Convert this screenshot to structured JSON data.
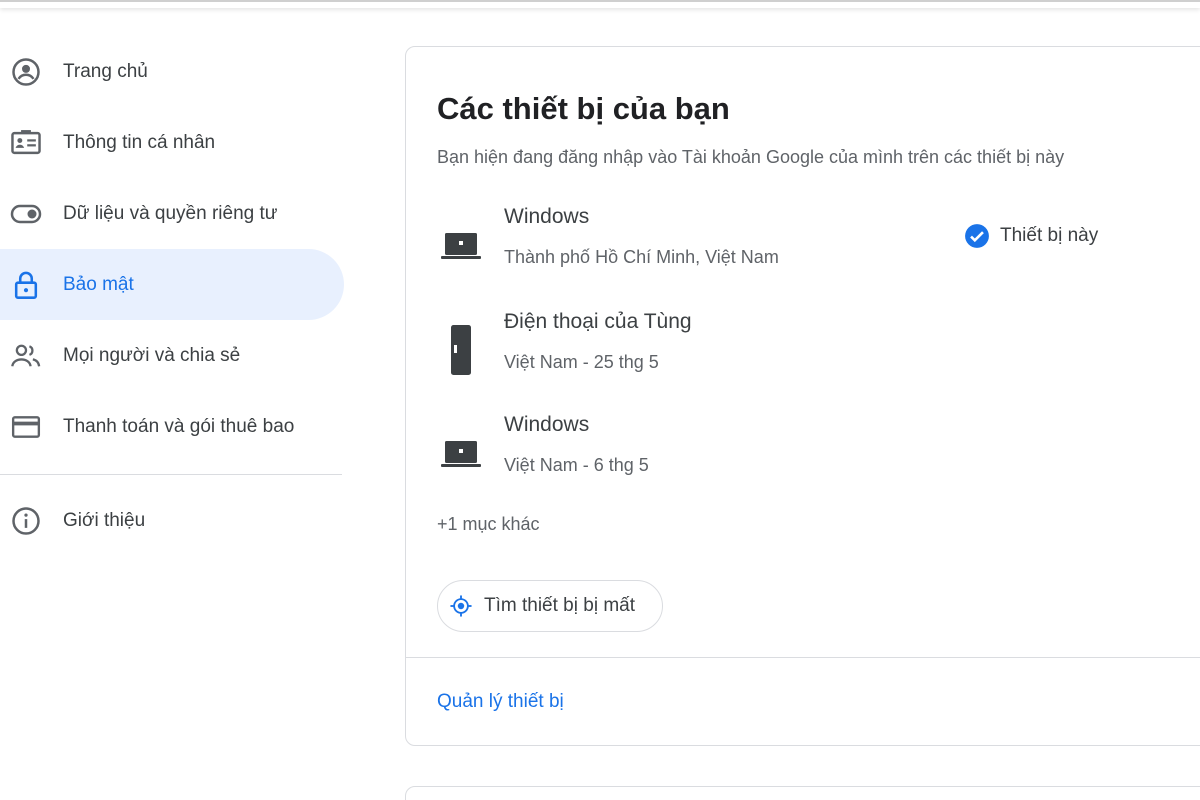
{
  "sidebar": {
    "items": [
      {
        "label": "Trang chủ",
        "icon": "home-account-icon"
      },
      {
        "label": "Thông tin cá nhân",
        "icon": "id-card-icon"
      },
      {
        "label": "Dữ liệu và quyền riêng tư",
        "icon": "toggle-icon"
      },
      {
        "label": "Bảo mật",
        "icon": "lock-icon",
        "active": true
      },
      {
        "label": "Mọi người và chia sẻ",
        "icon": "people-icon"
      },
      {
        "label": "Thanh toán và gói thuê bao",
        "icon": "credit-card-icon"
      }
    ],
    "about": {
      "label": "Giới thiệu",
      "icon": "info-icon"
    }
  },
  "devices_card": {
    "title": "Các thiết bị của bạn",
    "subtitle": "Bạn hiện đang đăng nhập vào Tài khoản Google của mình trên các thiết bị này",
    "devices": [
      {
        "name": "Windows",
        "meta": "Thành phố Hồ Chí Minh, Việt Nam",
        "type": "laptop-icon",
        "badge": "Thiết bị này"
      },
      {
        "name": "Điện thoại của Tùng",
        "meta": "Việt Nam - 25 thg 5",
        "type": "phone-icon"
      },
      {
        "name": "Windows",
        "meta": "Việt Nam - 6 thg 5",
        "type": "laptop-icon"
      }
    ],
    "more": "+1 mục khác",
    "find_button": "Tìm thiết bị bị mất",
    "manage_link": "Quản lý thiết bị"
  },
  "colors": {
    "accent": "#1a73e8",
    "active_bg": "#e8f0fe",
    "text": "#3c4043",
    "muted": "#5f6368",
    "border": "#dadce0"
  }
}
